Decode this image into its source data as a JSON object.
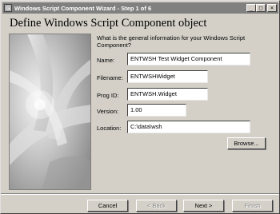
{
  "window": {
    "title": "Windows Script Component Wizard - Step 1 of 6",
    "minimize_glyph": "_",
    "maximize_glyph": "□",
    "close_glyph": "×"
  },
  "heading": "Define Windows Script Component object",
  "question": "What is the general information for your Windows Script Component?",
  "fields": {
    "name": {
      "label": "Name:",
      "value": "ENTWSH Test Widget Component"
    },
    "filename": {
      "label": "Filename:",
      "value": "ENTWSHWidget"
    },
    "progid": {
      "label": "Prog ID:",
      "value": "ENTWSH.Widget"
    },
    "version": {
      "label": "Version:",
      "value": "1.00"
    },
    "location": {
      "label": "Location:",
      "value": "C:\\data\\wsh"
    }
  },
  "buttons": {
    "browse": "Browse...",
    "cancel": "Cancel",
    "back": "< Back",
    "next": "Next >",
    "finish": "Finish"
  },
  "colors": {
    "titlebar": "#808080",
    "dialog_bg": "#d4d0c8"
  }
}
